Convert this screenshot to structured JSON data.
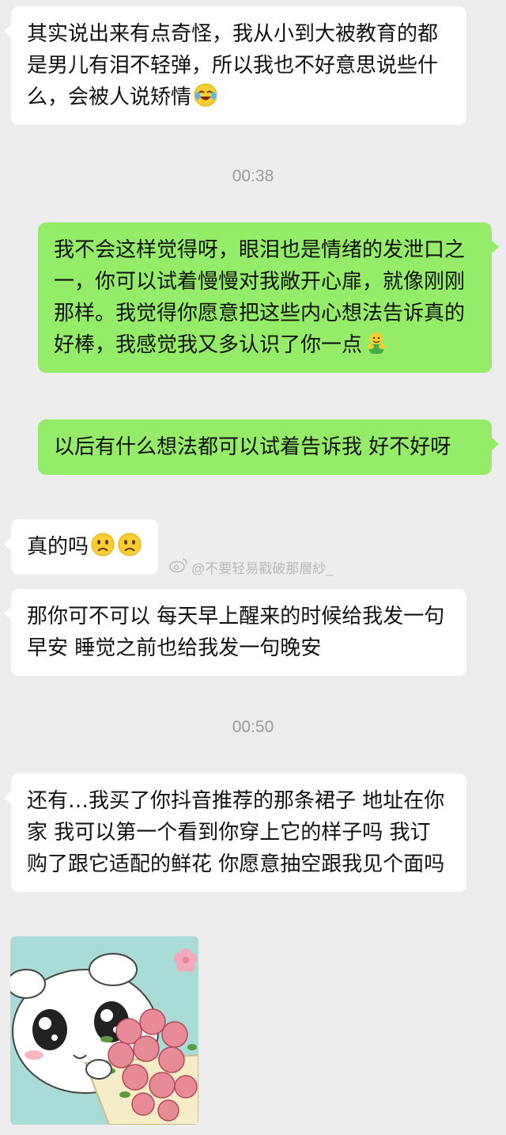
{
  "messages": [
    {
      "side": "left",
      "text": "其实说出来有点奇怪，我从小到大被教育的都是男儿有泪不轻弹，所以我也不好意思说些什么，会被人说矫情",
      "emoji": "laughing-crying-emoji"
    },
    {
      "type": "time",
      "text": "00:38"
    },
    {
      "side": "right",
      "text": "我不会这样觉得呀，眼泪也是情绪的发泄口之一，你可以试着慢慢对我敞开心扉，就像刚刚那样。我觉得你愿意把这些内心想法告诉真的好棒，我感觉我又多认识了你一点",
      "emoji": "hug-emoji"
    },
    {
      "side": "right",
      "text": "以后有什么想法都可以试着告诉我 好不好呀"
    },
    {
      "side": "left",
      "text": "真的吗",
      "emoji": "sad-face-emoji x2"
    },
    {
      "side": "left",
      "text": "那你可不可以 每天早上醒来的时候给我发一句早安 睡觉之前也给我发一句晚安"
    },
    {
      "type": "time",
      "text": "00:50"
    },
    {
      "side": "left",
      "text": "还有…我买了你抖音推荐的那条裙子 地址在你家 我可以第一个看到你穿上它的样子吗 我订购了跟它适配的鲜花 你愿意抽空跟我见个面吗"
    },
    {
      "side": "left",
      "type": "sticker",
      "sticker": "puppy-holding-roses-sticker"
    }
  ],
  "watermark": {
    "text": "@不要轻易戳破那層紗_",
    "icon": "weibo-icon"
  },
  "colors": {
    "background": "#ededed",
    "sent": "#95ec69",
    "received": "#ffffff",
    "time": "#9a9a9a"
  }
}
